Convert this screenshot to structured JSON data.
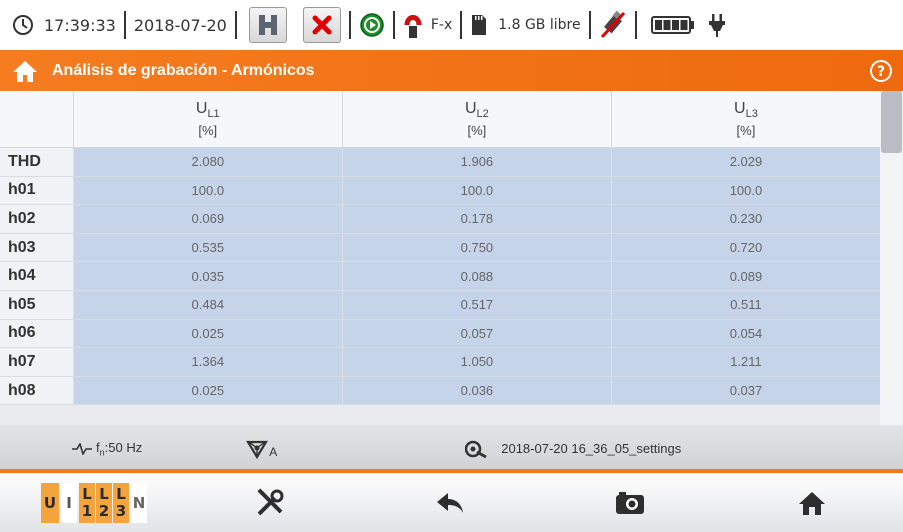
{
  "status": {
    "time": "17:39:33",
    "date": "2018-07-20",
    "clamp_label": "F-x",
    "storage": "1.8 GB libre"
  },
  "title": "Análisis de grabación - Armónicos",
  "table": {
    "columns": [
      {
        "main": "U",
        "sub": "L1",
        "unit": "[%]"
      },
      {
        "main": "U",
        "sub": "L2",
        "unit": "[%]"
      },
      {
        "main": "U",
        "sub": "L3",
        "unit": "[%]"
      }
    ],
    "rows": [
      {
        "label": "THD",
        "values": [
          "2.080",
          "1.906",
          "2.029"
        ]
      },
      {
        "label": "h01",
        "values": [
          "100.0",
          "100.0",
          "100.0"
        ]
      },
      {
        "label": "h02",
        "values": [
          "0.069",
          "0.178",
          "0.230"
        ]
      },
      {
        "label": "h03",
        "values": [
          "0.535",
          "0.750",
          "0.720"
        ]
      },
      {
        "label": "h04",
        "values": [
          "0.035",
          "0.088",
          "0.089"
        ]
      },
      {
        "label": "h05",
        "values": [
          "0.484",
          "0.517",
          "0.511"
        ]
      },
      {
        "label": "h06",
        "values": [
          "0.025",
          "0.057",
          "0.054"
        ]
      },
      {
        "label": "h07",
        "values": [
          "1.364",
          "1.050",
          "1.211"
        ]
      },
      {
        "label": "h08",
        "values": [
          "0.025",
          "0.036",
          "0.037"
        ]
      }
    ]
  },
  "info": {
    "freq_main": "f",
    "freq_sub": "n",
    "freq_value": ":50 Hz",
    "config_sub": "A",
    "settings_name": "2018-07-20 16_36_05_settings"
  },
  "toolbar": {
    "u_label": "U",
    "i_label": "I",
    "l_label": "L",
    "phase1": "1",
    "phase2": "2",
    "phase3": "3",
    "n_label": "N"
  },
  "colors": {
    "accent_orange": "#f07a1d",
    "cell_blue": "#c6d4ea",
    "title_text": "#ffffff"
  },
  "icons": [
    "clock-icon",
    "hold-icon",
    "stop-icon",
    "record-icon",
    "clamp-icon",
    "sd-card-icon",
    "usb-icon",
    "battery-icon",
    "power-plug-icon",
    "home-icon",
    "help-icon",
    "waveform-icon",
    "network-config-icon",
    "probe-icon",
    "settings-tools-icon",
    "back-icon",
    "camera-icon"
  ]
}
